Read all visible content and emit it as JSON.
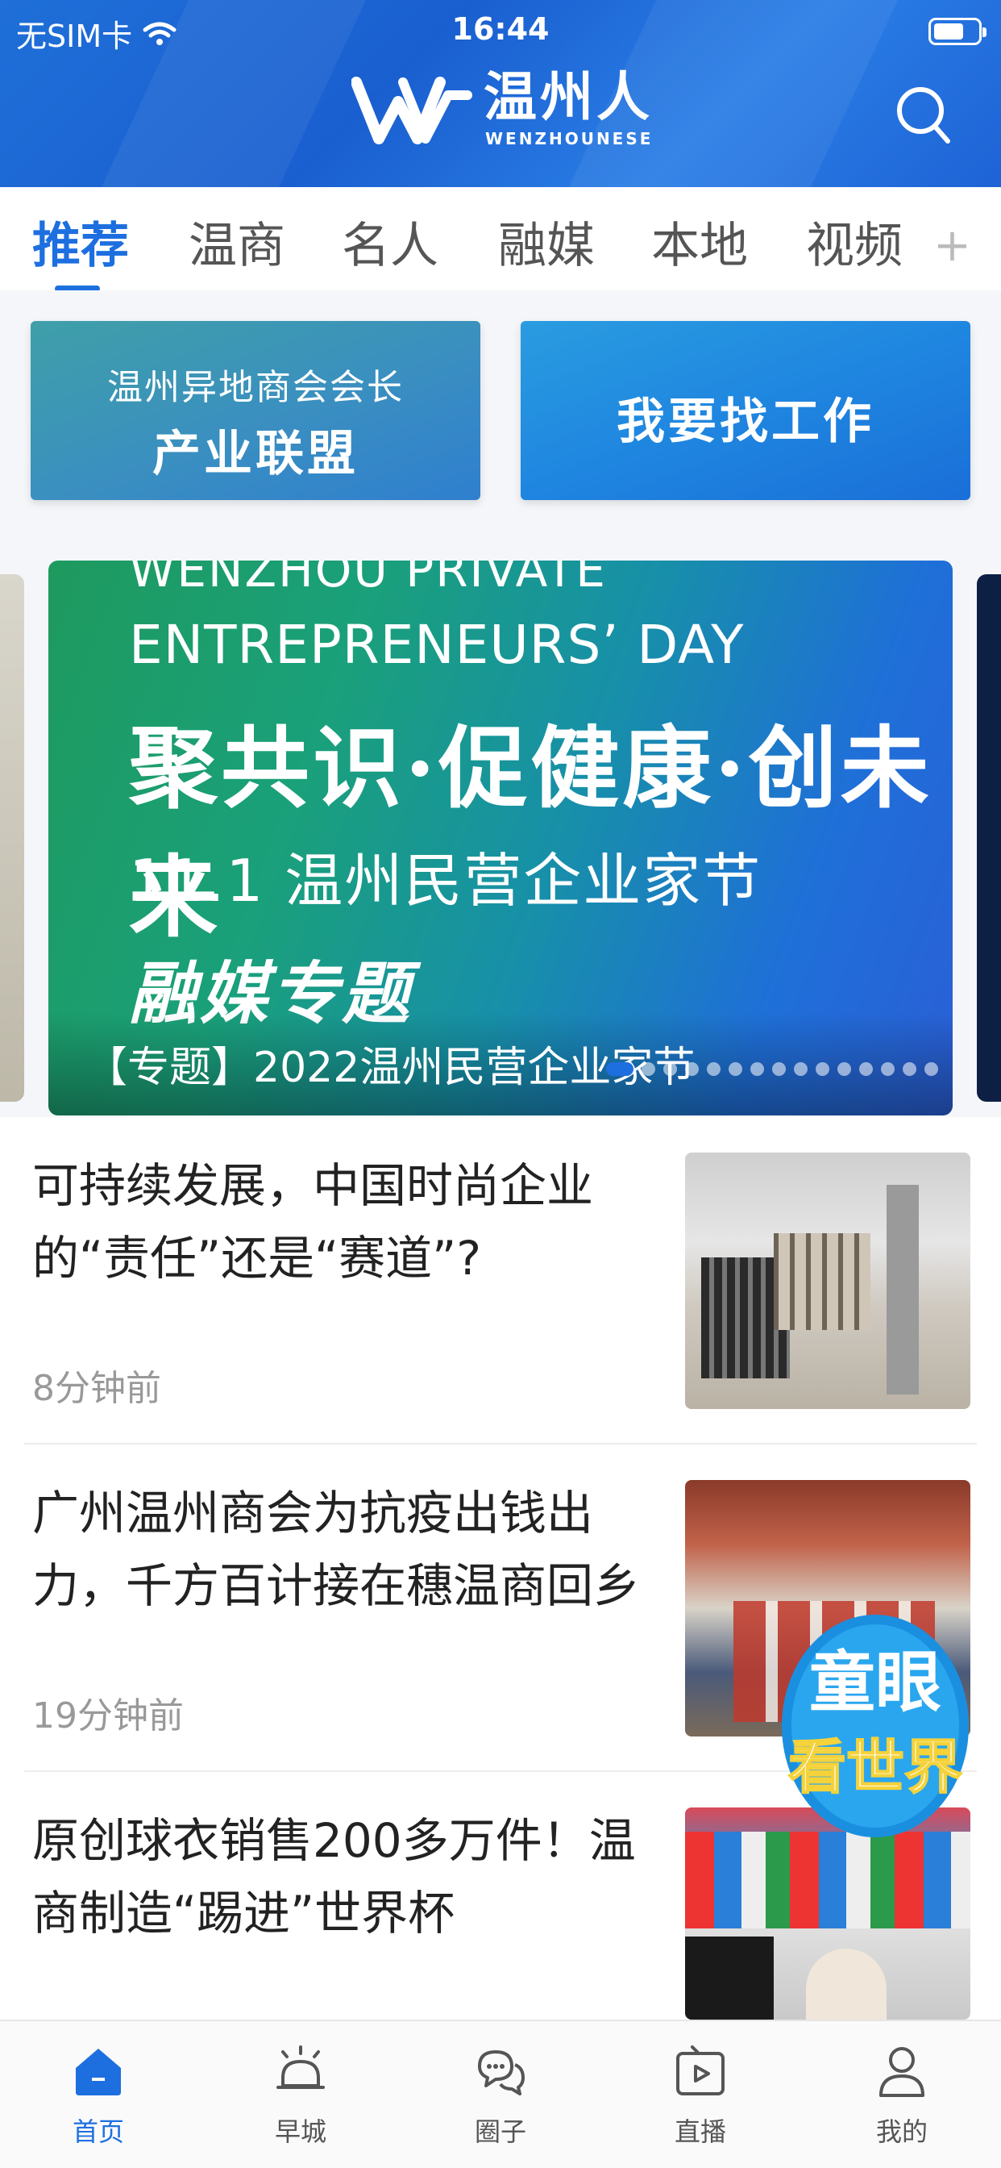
{
  "status_bar": {
    "carrier": "无SIM卡",
    "time": "16:44"
  },
  "header": {
    "logo_cn": "温州人",
    "logo_en": "WENZHOUNESE"
  },
  "tabs": [
    {
      "label": "推荐",
      "active": true
    },
    {
      "label": "温商",
      "active": false
    },
    {
      "label": "名人",
      "active": false
    },
    {
      "label": "融媒",
      "active": false
    },
    {
      "label": "本地",
      "active": false
    },
    {
      "label": "视频",
      "active": false
    }
  ],
  "tabs_more": "+",
  "quick_buttons": [
    {
      "sub": "温州异地商会会长",
      "main": "产业联盟"
    },
    {
      "main": "我要找工作"
    }
  ],
  "banner": {
    "en_line1": "WENZHOU PRIVATE",
    "en_line2": "ENTREPRENEURS’ DAY",
    "calligraphy": "聚共识·促健康·创未来",
    "date_line": "11.1 温州民营企业家节",
    "special": "融媒专题",
    "caption": "【专题】2022温州民营企业家节",
    "dots_total": 15,
    "active_dot": 1
  },
  "news": [
    {
      "title": "可持续发展，中国时尚企业的“责任”还是“赛道”?",
      "time": "8分钟前"
    },
    {
      "title": "广州温州商会为抗疫出钱出力，千方百计接在穗温商回乡",
      "time": "19分钟前"
    },
    {
      "title": "原创球衣销售200多万件！温商制造“踢进”世界杯",
      "time": ""
    }
  ],
  "floating_badge": {
    "line1": "童眼",
    "line2": "看世界"
  },
  "bottom_nav": [
    {
      "label": "首页",
      "icon": "home-icon",
      "active": true
    },
    {
      "label": "早城",
      "icon": "alarm-bell-icon",
      "active": false
    },
    {
      "label": "圈子",
      "icon": "chat-bubbles-icon",
      "active": false
    },
    {
      "label": "直播",
      "icon": "live-play-icon",
      "active": false
    },
    {
      "label": "我的",
      "icon": "profile-icon",
      "active": false
    }
  ],
  "colors": {
    "brand_blue": "#1d6fe0",
    "header_blue": "#1f6fd8",
    "text_gray": "#999999"
  }
}
